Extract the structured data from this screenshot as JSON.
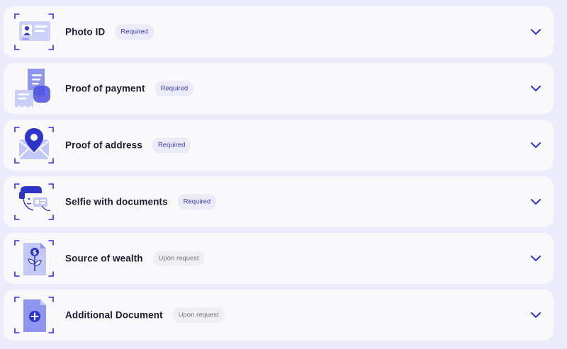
{
  "colors": {
    "accent": "#2f34c9",
    "page_bg": "#ecebfb",
    "row_bg": "#f9f9fc",
    "badge_required_text": "#3b3fb8",
    "badge_request_text": "#73737f"
  },
  "documents": [
    {
      "label": "Photo ID",
      "badge": "Required",
      "badge_type": "required",
      "icon": "photo-id-icon"
    },
    {
      "label": "Proof of payment",
      "badge": "Required",
      "badge_type": "required",
      "icon": "receipt-icon"
    },
    {
      "label": "Proof of address",
      "badge": "Required",
      "badge_type": "required",
      "icon": "map-pin-icon"
    },
    {
      "label": "Selfie with documents",
      "badge": "Required",
      "badge_type": "required",
      "icon": "selfie-icon"
    },
    {
      "label": "Source of wealth",
      "badge": "Upon request",
      "badge_type": "request",
      "icon": "money-plant-icon"
    },
    {
      "label": "Additional Document",
      "badge": "Upon request",
      "badge_type": "request",
      "icon": "add-document-icon"
    }
  ]
}
